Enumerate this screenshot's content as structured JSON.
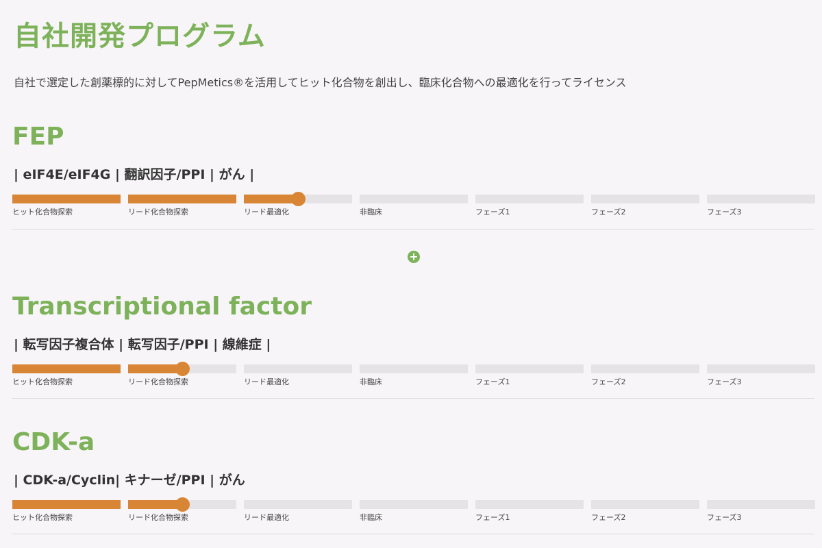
{
  "page": {
    "title": "自社開発プログラム",
    "intro": "自社で選定した創薬標的に対してPepMetics®を活用してヒット化合物を創出し、臨床化合物への最適化を行ってライセンス"
  },
  "stage_labels": [
    "ヒット化合物探索",
    "リード化合物探索",
    "リード最適化",
    "非臨床",
    "フェーズ1",
    "フェーズ2",
    "フェーズ3"
  ],
  "colors": {
    "accent": "#7db25a",
    "progress": "#d88535",
    "track": "#e6e3e6"
  },
  "programs": [
    {
      "name": "FEP",
      "tags": "| eIF4E/eIF4G | 翻訳因子/PPI | がん |",
      "progress_stage_index": 2,
      "progress_within_stage": 0.5
    },
    {
      "name": "Transcriptional factor",
      "tags": "| 転写因子複合体 | 転写因子/PPI | 線維症 |",
      "progress_stage_index": 1,
      "progress_within_stage": 0.5
    },
    {
      "name": "CDK-a",
      "tags": "| CDK-a/Cyclin| キナーゼ/PPI | がん",
      "progress_stage_index": 1,
      "progress_within_stage": 0.5
    }
  ],
  "expand_button": {
    "icon": "plus-icon",
    "label": "+"
  }
}
